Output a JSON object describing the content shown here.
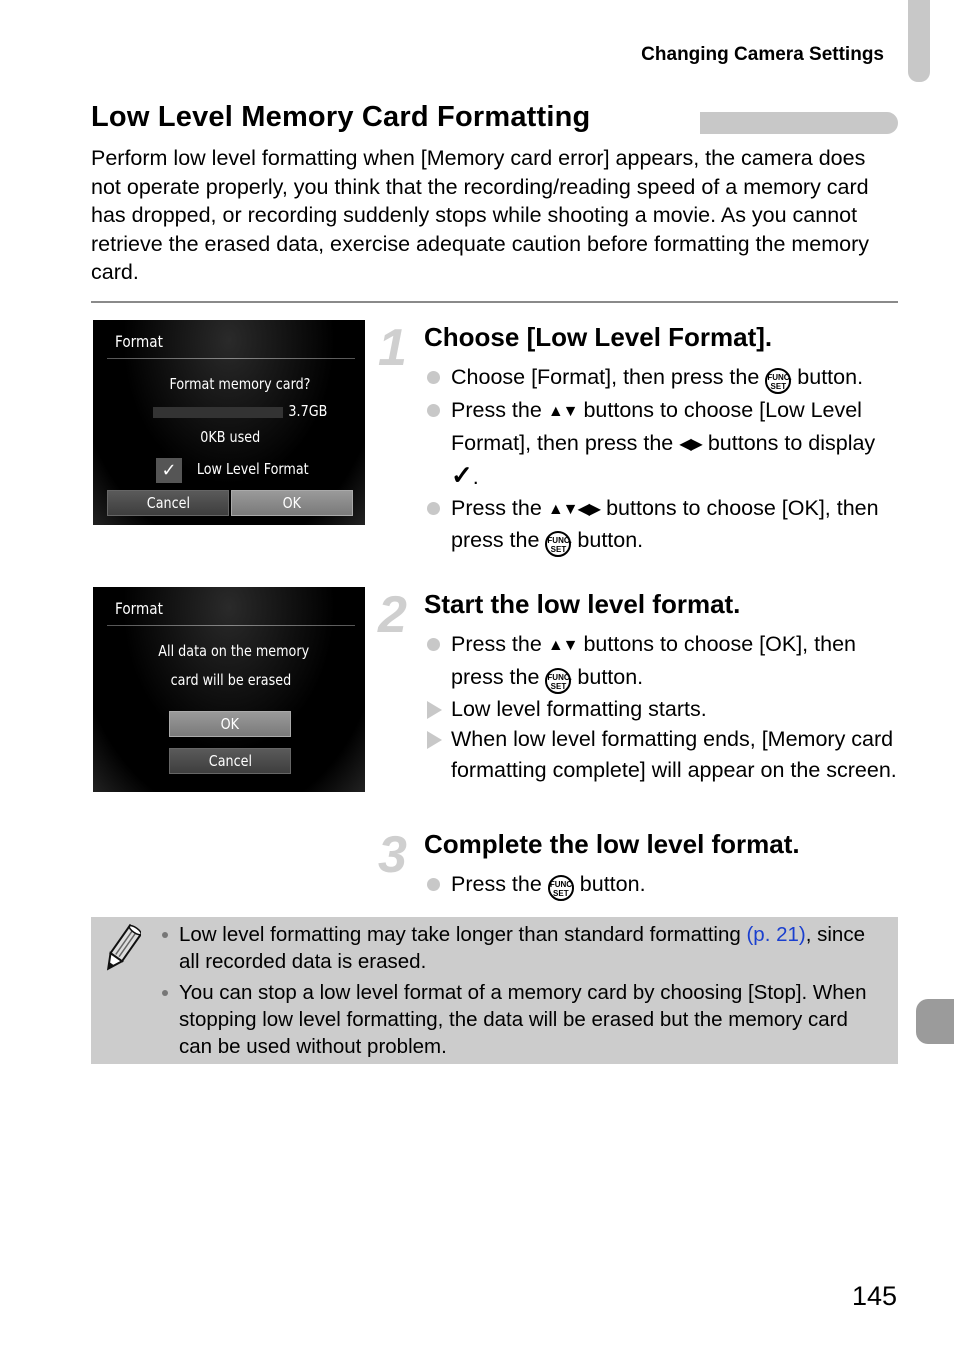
{
  "header": {
    "running_head": "Changing Camera Settings"
  },
  "section": {
    "title": "Low Level Memory Card Formatting",
    "intro": "Perform low level formatting when [Memory card error] appears, the camera does not operate properly, you think that the recording/reading speed of a memory card has dropped, or recording suddenly stops while shooting a movie. As you cannot retrieve the erased data, exercise adequate caution before formatting the memory card."
  },
  "screens": {
    "format_confirm": {
      "title": "Format",
      "question": "Format memory card?",
      "capacity": "3.7GB",
      "used_fraction": 0,
      "used": "0KB used",
      "checkbox_label": "Low Level Format",
      "checkbox_checked": true,
      "checkmark": "✓",
      "cancel": "Cancel",
      "ok": "OK"
    },
    "erase_confirm": {
      "title": "Format",
      "line1": "All data on the memory",
      "line2": "card will be erased",
      "ok": "OK",
      "cancel": "Cancel"
    }
  },
  "icons": {
    "func_top": "FUNC.",
    "func_bottom": "SET",
    "up_down": "▲▼",
    "left_right": "◀▶",
    "check": "✓"
  },
  "steps": [
    {
      "number": "1",
      "title": "Choose [Low Level Format].",
      "items": [
        {
          "pre": "Choose [Format], then press the",
          "post": "button."
        },
        {
          "pre": "Press the",
          "mid": "buttons to choose [Low Level Format], then press the",
          "post": "buttons to display",
          "end": "."
        },
        {
          "pre": "Press the",
          "post": "buttons to choose [OK], then press the",
          "end": "button."
        }
      ]
    },
    {
      "number": "2",
      "title": "Start the low level format.",
      "items": [
        {
          "pre": "Press the",
          "post": "buttons to choose [OK], then press the",
          "end": "button."
        },
        {
          "text": "Low level formatting starts."
        },
        {
          "text": "When low level formatting ends, [Memory card formatting complete] will appear on the screen."
        }
      ]
    },
    {
      "number": "3",
      "title": "Complete the low level format.",
      "items": [
        {
          "pre": "Press the",
          "post": "button."
        }
      ]
    }
  ],
  "note": {
    "items": [
      {
        "text": "Low level formatting may take longer than standard formatting",
        "link": "(p. 21)",
        "after": ", since all recorded data is erased."
      },
      {
        "text": "You can stop a low level format of a memory card by choosing [Stop]. When stopping low level formatting, the data will be erased but the memory card can be used without problem."
      }
    ]
  },
  "colors": {
    "link": "#1a3fcf",
    "accent_gray": "#c8c8c8",
    "note_bg": "#cccccc"
  },
  "page_number": "145"
}
